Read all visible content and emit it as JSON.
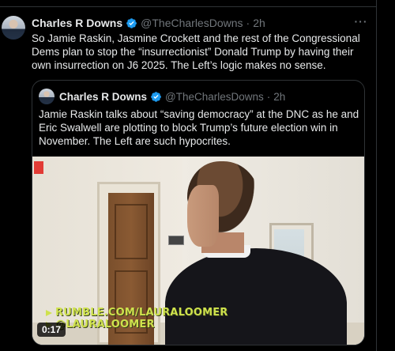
{
  "tweet": {
    "author_name": "Charles R Downs",
    "handle": "@TheCharlesDowns",
    "separator": "·",
    "time": "2h",
    "more_label": "···",
    "text": "So Jamie Raskin, Jasmine Crockett and the rest of the Congressional Dems plan to stop the “insurrectionist” Donald Trump by having their own insurrection on J6 2025. The Left’s logic makes no sense."
  },
  "quote": {
    "author_name": "Charles R Downs",
    "handle": "@TheCharlesDowns",
    "separator": "·",
    "time": "2h",
    "text": "Jamie Raskin talks about “saving democracy” at the DNC as he and Eric Swalwell are plotting to block Trump’s future election win in November. The Left are such hypocrites.",
    "video": {
      "watermark_line1": "RUMBLE.COM/LAURALOOMER",
      "watermark_line2": "@LAURALOOMER",
      "duration": "0:17"
    }
  },
  "colors": {
    "background": "#000000",
    "text": "#e7e9ea",
    "muted": "#71767b",
    "verified": "#1d9bf0",
    "border": "#2f3336"
  }
}
